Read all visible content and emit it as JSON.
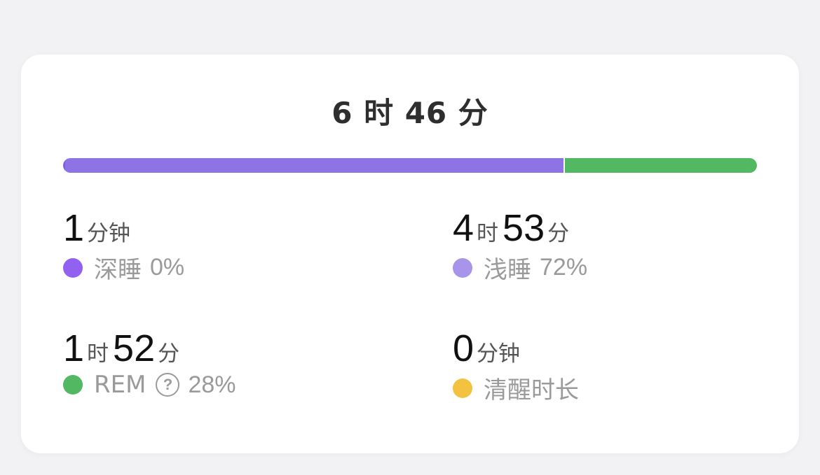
{
  "summary": {
    "total_hours": "6",
    "hour_unit": "时",
    "total_minutes": "46",
    "minute_unit": "分"
  },
  "bar": {
    "deep_fraction": 0.003,
    "light_fraction": 0.72,
    "rem_fraction": 0.277,
    "colors": {
      "deep": "#7f5fe0",
      "light": "#8d73e3",
      "rem": "#53b862"
    }
  },
  "stats": {
    "deep": {
      "num1": "1",
      "unit1": "分钟",
      "label": "深睡",
      "percent": "0%",
      "color": "#9261f0"
    },
    "light": {
      "num1": "4",
      "unit1": "时",
      "num2": "53",
      "unit2": "分",
      "label": "浅睡",
      "percent": "72%",
      "color": "#a895ea"
    },
    "rem": {
      "num1": "1",
      "unit1": "时",
      "num2": "52",
      "unit2": "分",
      "label": "REM",
      "help_icon": "?",
      "percent": "28%",
      "color": "#53b862"
    },
    "awake": {
      "num1": "0",
      "unit1": "分钟",
      "label": "清醒时长",
      "color": "#f2c240"
    }
  }
}
